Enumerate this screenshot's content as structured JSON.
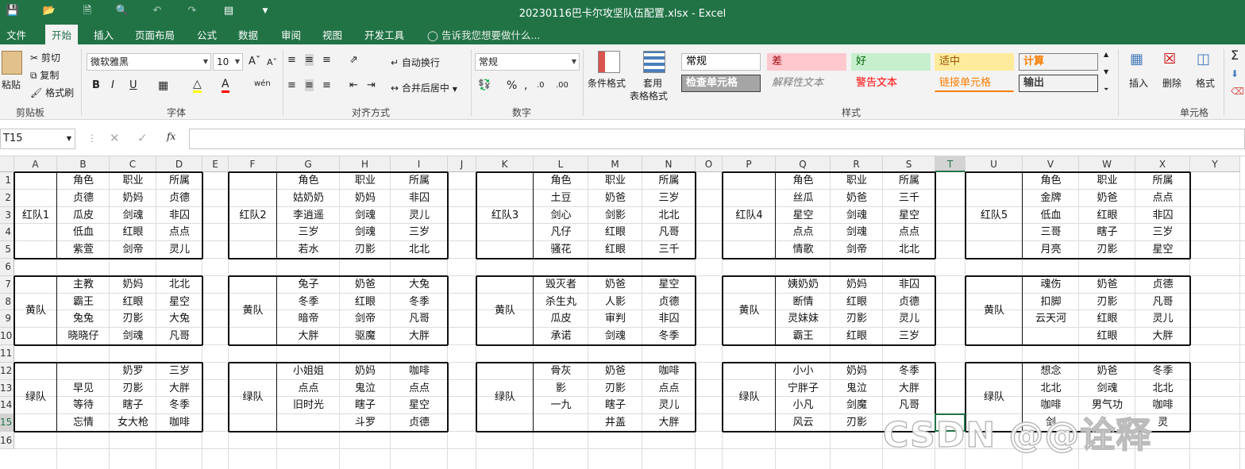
{
  "window": {
    "title": "20230116巴卡尔攻坚队伍配置.xlsx - Excel"
  },
  "tabs": [
    "文件",
    "开始",
    "插入",
    "页面布局",
    "公式",
    "数据",
    "审阅",
    "视图",
    "开发工具"
  ],
  "tell_me": "告诉我您想要做什么...",
  "ribbon": {
    "clipboard": {
      "paste": "粘贴",
      "cut": "剪切",
      "copy": "复制",
      "format_painter": "格式刷",
      "label": "剪贴板"
    },
    "font": {
      "name": "微软雅黑",
      "size": "10",
      "label": "字体",
      "bold": "B",
      "italic": "I",
      "underline": "U",
      "phonetic": "wén"
    },
    "alignment": {
      "wrap": "自动换行",
      "merge": "合并后居中",
      "label": "对齐方式"
    },
    "number": {
      "format": "常规",
      "label": "数字"
    },
    "styles": {
      "conditional": "条件格式",
      "table_format_1": "套用",
      "table_format_2": "表格格式",
      "label": "样式",
      "cells": [
        {
          "text": "常规",
          "bg": "#ffffff",
          "fg": "#000000",
          "border": "#bbbbbb"
        },
        {
          "text": "差",
          "bg": "#ffc7ce",
          "fg": "#9c0006",
          "border": "#ffc7ce"
        },
        {
          "text": "好",
          "bg": "#c6efce",
          "fg": "#006100",
          "border": "#c6efce"
        },
        {
          "text": "适中",
          "bg": "#ffeb9c",
          "fg": "#9c5700",
          "border": "#ffeb9c"
        },
        {
          "text": "计算",
          "bg": "#f2f2f2",
          "fg": "#fa7d00",
          "border": "#7f7f7f"
        },
        {
          "text": "检查单元格",
          "bg": "#a5a5a5",
          "fg": "#ffffff",
          "border": "#3f3f3f"
        },
        {
          "text": "解释性文本",
          "bg": "transparent",
          "fg": "#7f7f7f",
          "border": "transparent"
        },
        {
          "text": "警告文本",
          "bg": "transparent",
          "fg": "#ff0000",
          "border": "transparent"
        },
        {
          "text": "链接单元格",
          "bg": "transparent",
          "fg": "#fa7d00",
          "border": "transparent"
        },
        {
          "text": "输出",
          "bg": "#f2f2f2",
          "fg": "#3f3f3f",
          "border": "#3f3f3f"
        }
      ]
    },
    "cells": {
      "insert": "插入",
      "delete": "删除",
      "format": "格式",
      "label": "单元格"
    }
  },
  "namebox": "T15",
  "fx": "fx",
  "selected": {
    "col": "T",
    "row": "15"
  },
  "columns": [
    "A",
    "B",
    "C",
    "D",
    "E",
    "F",
    "G",
    "H",
    "I",
    "J",
    "K",
    "L",
    "M",
    "N",
    "O",
    "P",
    "Q",
    "R",
    "S",
    "T",
    "U",
    "V",
    "W",
    "X",
    "Y"
  ],
  "rows": [
    "1",
    "2",
    "3",
    "4",
    "5",
    "6",
    "7",
    "8",
    "9",
    "10",
    "11",
    "12",
    "13",
    "14",
    "15",
    "16"
  ],
  "teams": [
    {
      "label": "红队1",
      "row": 0,
      "block": 0,
      "cells": [
        [
          "角色",
          "职业",
          "所属"
        ],
        [
          "贞德",
          "奶妈",
          "贞德"
        ],
        [
          "瓜皮",
          "剑魂",
          "非囚"
        ],
        [
          "低血",
          "红眼",
          "点点"
        ],
        [
          "紫萱",
          "剑帝",
          "灵儿"
        ]
      ]
    },
    {
      "label": "红队2",
      "row": 0,
      "block": 1,
      "cells": [
        [
          "角色",
          "职业",
          "所属"
        ],
        [
          "姑奶奶",
          "奶妈",
          "非囚"
        ],
        [
          "李逍遥",
          "剑魂",
          "灵儿"
        ],
        [
          "三岁",
          "剑魂",
          "三岁"
        ],
        [
          "若水",
          "刃影",
          "北北"
        ]
      ]
    },
    {
      "label": "红队3",
      "row": 0,
      "block": 2,
      "cells": [
        [
          "角色",
          "职业",
          "所属"
        ],
        [
          "土豆",
          "奶爸",
          "三岁"
        ],
        [
          "剑心",
          "剑影",
          "北北"
        ],
        [
          "凡仔",
          "红眼",
          "凡哥"
        ],
        [
          "骚花",
          "红眼",
          "三千"
        ]
      ]
    },
    {
      "label": "红队4",
      "row": 0,
      "block": 3,
      "cells": [
        [
          "角色",
          "职业",
          "所属"
        ],
        [
          "丝瓜",
          "奶爸",
          "三千"
        ],
        [
          "星空",
          "剑魂",
          "星空"
        ],
        [
          "点点",
          "剑魂",
          "点点"
        ],
        [
          "情歌",
          "剑帝",
          "北北"
        ]
      ]
    },
    {
      "label": "红队5",
      "row": 0,
      "block": 4,
      "cells": [
        [
          "角色",
          "职业",
          "所属"
        ],
        [
          "金牌",
          "奶爸",
          "点点"
        ],
        [
          "低血",
          "红眼",
          "非囚"
        ],
        [
          "三哥",
          "瞎子",
          "三岁"
        ],
        [
          "月亮",
          "刃影",
          "星空"
        ]
      ]
    },
    {
      "label": "黄队",
      "row": 1,
      "block": 0,
      "cells": [
        [
          "主教",
          "奶妈",
          "北北"
        ],
        [
          "霸王",
          "红眼",
          "星空"
        ],
        [
          "兔兔",
          "刃影",
          "大兔"
        ],
        [
          "晓晓仔",
          "剑魂",
          "凡哥"
        ]
      ]
    },
    {
      "label": "黄队",
      "row": 1,
      "block": 1,
      "cells": [
        [
          "兔子",
          "奶爸",
          "大兔"
        ],
        [
          "冬季",
          "红眼",
          "冬季"
        ],
        [
          "暗帝",
          "剑帝",
          "凡哥"
        ],
        [
          "大胖",
          "驱魔",
          "大胖"
        ]
      ]
    },
    {
      "label": "黄队",
      "row": 1,
      "block": 2,
      "cells": [
        [
          "毁灭者",
          "奶爸",
          "星空"
        ],
        [
          "杀生丸",
          "人影",
          "贞德"
        ],
        [
          "瓜皮",
          "审判",
          "非囚"
        ],
        [
          "承诺",
          "剑魂",
          "冬季"
        ]
      ]
    },
    {
      "label": "黄队",
      "row": 1,
      "block": 3,
      "cells": [
        [
          "姨奶奶",
          "奶妈",
          "非囚"
        ],
        [
          "断情",
          "红眼",
          "贞德"
        ],
        [
          "灵妹妹",
          "刃影",
          "灵儿"
        ],
        [
          "霸王",
          "红眼",
          "三岁"
        ]
      ]
    },
    {
      "label": "黄队",
      "row": 1,
      "block": 4,
      "cells": [
        [
          "魂伤",
          "奶爸",
          "贞德"
        ],
        [
          "扣脚",
          "刃影",
          "凡哥"
        ],
        [
          "云天河",
          "红眼",
          "灵儿"
        ],
        [
          "",
          "红眼",
          "大胖"
        ]
      ]
    },
    {
      "label": "绿队",
      "row": 2,
      "block": 0,
      "cells": [
        [
          "",
          "奶罗",
          "三岁"
        ],
        [
          "早见",
          "刃影",
          "大胖"
        ],
        [
          "等待",
          "瞎子",
          "冬季"
        ],
        [
          "忘情",
          "女大枪",
          "咖啡"
        ]
      ]
    },
    {
      "label": "绿队",
      "row": 2,
      "block": 1,
      "cells": [
        [
          "小姐姐",
          "奶妈",
          "咖啡"
        ],
        [
          "点点",
          "鬼泣",
          "点点"
        ],
        [
          "旧时光",
          "瞎子",
          "星空"
        ],
        [
          "",
          "斗罗",
          "贞德"
        ]
      ]
    },
    {
      "label": "绿队",
      "row": 2,
      "block": 2,
      "cells": [
        [
          "骨灰",
          "奶爸",
          "咖啡"
        ],
        [
          "影",
          "刃影",
          "点点"
        ],
        [
          "一九",
          "瞎子",
          "灵儿"
        ],
        [
          "",
          "井盖",
          "大胖"
        ]
      ]
    },
    {
      "label": "绿队",
      "row": 2,
      "block": 3,
      "cells": [
        [
          "小小",
          "奶妈",
          "冬季"
        ],
        [
          "宁胖子",
          "鬼泣",
          "大胖"
        ],
        [
          "小凡",
          "剑魔",
          "凡哥"
        ],
        [
          "风云",
          "刃影",
          ""
        ]
      ]
    },
    {
      "label": "绿队",
      "row": 2,
      "block": 4,
      "cells": [
        [
          "想念",
          "奶爸",
          "冬季"
        ],
        [
          "北北",
          "剑魂",
          "北北"
        ],
        [
          "咖啡",
          "男气功",
          "咖啡"
        ],
        [
          "剑",
          "",
          "灵"
        ]
      ]
    }
  ],
  "watermark": "CSDN @@诠释"
}
